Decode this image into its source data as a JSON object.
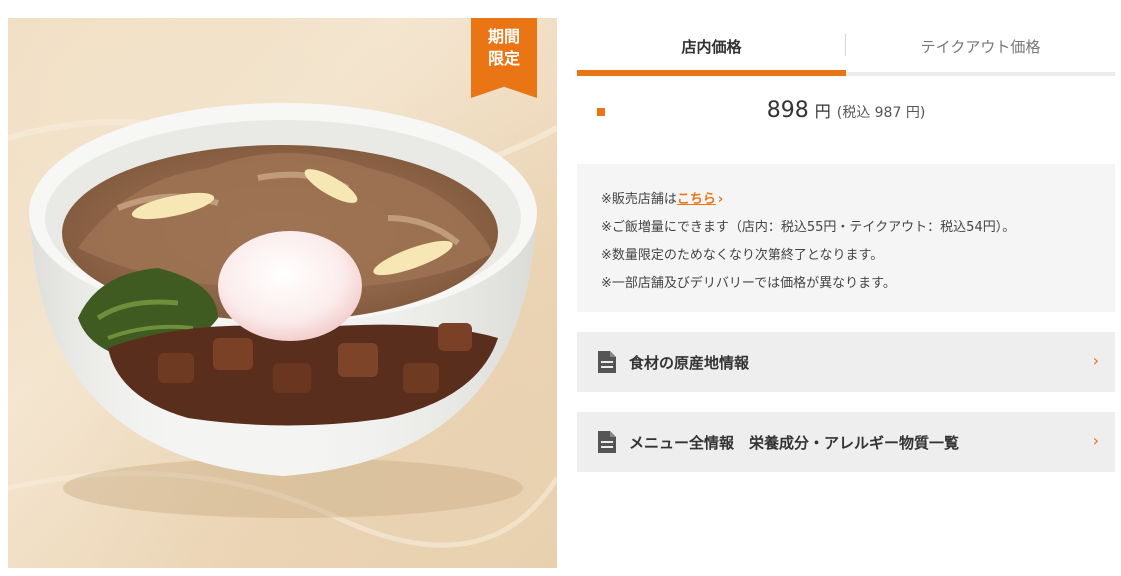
{
  "product_image": {
    "alt": ""
  },
  "badge": {
    "line1": "期間",
    "line2": "限定"
  },
  "tabs": [
    {
      "label": "店内価格",
      "active": true
    },
    {
      "label": "テイクアウト価格",
      "active": false
    }
  ],
  "price": {
    "amount": "898",
    "unit": "円",
    "tax_included": "(税込 987 円)"
  },
  "notes": {
    "store_prefix": "※販売店舗は",
    "store_link": "こちら",
    "store_link_icon": "chevron-right-icon",
    "rice": "※ご飯増量にできます（店内：税込55円・テイクアウト：税込54円）。",
    "limited": "※数量限定のためなくなり次第終了となります。",
    "price_varies": "※一部店舗及びデリバリーでは価格が異なります。"
  },
  "links": [
    {
      "label": "食材の原産地情報",
      "icon": "document-icon"
    },
    {
      "label": "メニュー全情報　栄養成分・アレルギー物質一覧",
      "icon": "document-icon"
    }
  ],
  "colors": {
    "accent": "#ea7515",
    "panel_bg": "#eeeeee",
    "notes_bg": "#f5f5f5"
  }
}
